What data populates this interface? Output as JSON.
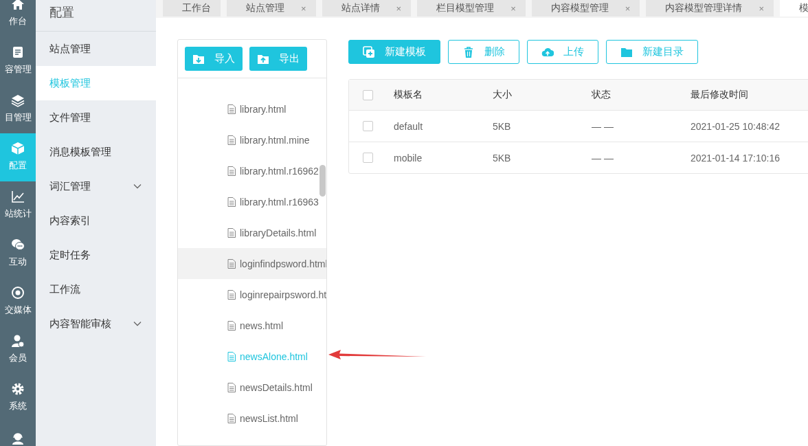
{
  "nav_rail": {
    "items": [
      {
        "label": "作台",
        "selected": false
      },
      {
        "label": "容管理",
        "selected": false
      },
      {
        "label": "目管理",
        "selected": false
      },
      {
        "label": "配置",
        "selected": true
      },
      {
        "label": "站统计",
        "selected": false
      },
      {
        "label": "互动",
        "selected": false
      },
      {
        "label": "交媒体",
        "selected": false
      },
      {
        "label": "会员",
        "selected": false
      },
      {
        "label": "系统",
        "selected": false
      },
      {
        "selected": false
      }
    ]
  },
  "sidebar": {
    "title": "配置",
    "items": [
      {
        "label": "站点管理",
        "selected": false
      },
      {
        "label": "模板管理",
        "selected": true
      },
      {
        "label": "文件管理",
        "selected": false
      },
      {
        "label": "消息模板管理",
        "selected": false
      },
      {
        "label": "词汇管理",
        "selected": false,
        "expanded": false
      },
      {
        "label": "内容索引",
        "selected": false
      },
      {
        "label": "定时任务",
        "selected": false
      },
      {
        "label": "工作流",
        "selected": false
      },
      {
        "label": "内容智能审核",
        "selected": false,
        "expanded": false
      }
    ]
  },
  "tabs": [
    {
      "label": "工作台",
      "selected": false
    },
    {
      "label": "站点管理",
      "selected": false,
      "close": "×"
    },
    {
      "label": "站点详情",
      "selected": false,
      "close": "×"
    },
    {
      "label": "栏目模型管理",
      "selected": false,
      "close": "×"
    },
    {
      "label": "内容模型管理",
      "selected": false,
      "close": "×"
    },
    {
      "label": "内容模型管理详情",
      "selected": false,
      "close": "×"
    },
    {
      "label": "模",
      "selected": true
    }
  ],
  "file_panel": {
    "buttons": [
      {
        "label": "导入",
        "kind": "import"
      },
      {
        "label": "导出",
        "kind": "export"
      }
    ],
    "files": [
      {
        "name": "library.html",
        "selected": false,
        "highlighted": false
      },
      {
        "name": "library.html.mine",
        "selected": false,
        "highlighted": false
      },
      {
        "name": "library.html.r16962",
        "selected": false,
        "highlighted": false
      },
      {
        "name": "library.html.r16963",
        "selected": false,
        "highlighted": false
      },
      {
        "name": "libraryDetails.html",
        "selected": false,
        "highlighted": false
      },
      {
        "name": "loginfindpsword.html",
        "selected": false,
        "highlighted": true
      },
      {
        "name": "loginrepairpsword.ht",
        "selected": false,
        "highlighted": false
      },
      {
        "name": "news.html",
        "selected": false,
        "highlighted": false
      },
      {
        "name": "newsAlone.html",
        "selected": true,
        "highlighted": false
      },
      {
        "name": "newsDetails.html",
        "selected": false,
        "highlighted": false
      },
      {
        "name": "newsList.html",
        "selected": false,
        "highlighted": false
      }
    ]
  },
  "toolbar": [
    {
      "label": "新建模板",
      "kind": "new"
    },
    {
      "label": "删除",
      "kind": "delete"
    },
    {
      "label": "上传",
      "kind": "upload"
    },
    {
      "label": "新建目录",
      "kind": "folder"
    }
  ],
  "table": {
    "header_checked": false,
    "columns": [
      "模板名",
      "大小",
      "状态",
      "最后修改时间"
    ],
    "rows": [
      {
        "checked": false,
        "cells": [
          "default",
          "5KB",
          "— —",
          "2021-01-25 10:48:42"
        ]
      },
      {
        "checked": false,
        "cells": [
          "mobile",
          "5KB",
          "— —",
          "2021-01-14 17:10:16"
        ]
      }
    ]
  }
}
